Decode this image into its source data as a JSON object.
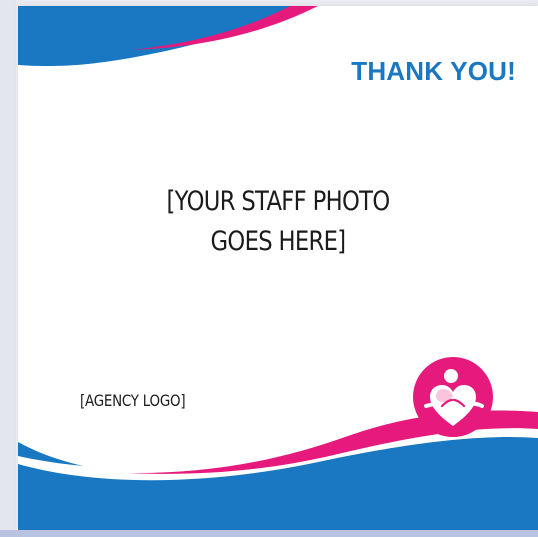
{
  "card": {
    "heading": "THANK YOU!",
    "photo_placeholder_line1": "[YOUR STAFF PHOTO",
    "photo_placeholder_line2": "GOES HERE]",
    "agency_logo_placeholder": "[AGENCY LOGO]"
  },
  "emblem": {
    "icon": "heart-hug-icon"
  },
  "colors": {
    "brand_blue": "#1a78c2",
    "brand_pink": "#e6197c",
    "text": "#1b1b1b",
    "background": "#ffffff"
  }
}
